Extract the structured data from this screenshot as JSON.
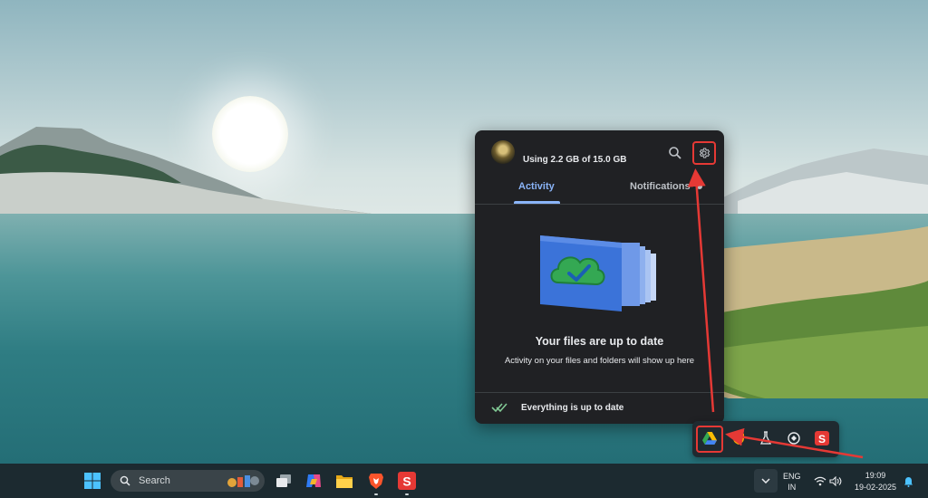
{
  "drive_popup": {
    "storage_text": "Using 2.2 GB of 15.0 GB",
    "tabs": [
      {
        "label": "Activity",
        "active": true
      },
      {
        "label": "Notifications",
        "active": false
      }
    ],
    "empty_state_title": "Your files are up to date",
    "empty_state_subtitle": "Activity on your files and folders will show up here",
    "status_text": "Everything is up to date",
    "icons": {
      "search": "search-icon",
      "settings": "gear-icon",
      "status": "double-check-icon"
    }
  },
  "tray_overflow": {
    "icons": [
      "google-drive-icon",
      "shield-app-icon",
      "flask-icon",
      "security-app-icon",
      "scribd-s-icon"
    ]
  },
  "taskbar": {
    "search_label": "Search",
    "apps": [
      "task-view-icon",
      "copilot-icon",
      "file-explorer-icon",
      "brave-icon",
      "s-app-icon"
    ],
    "language_line1": "ENG",
    "language_line2": "IN",
    "time": "19:09",
    "date": "19-02-2025"
  },
  "colors": {
    "accent_blue": "#8ab4f8",
    "highlight_red": "#e53935",
    "popup_bg": "#202124",
    "taskbar_bg": "#1c2a30"
  }
}
